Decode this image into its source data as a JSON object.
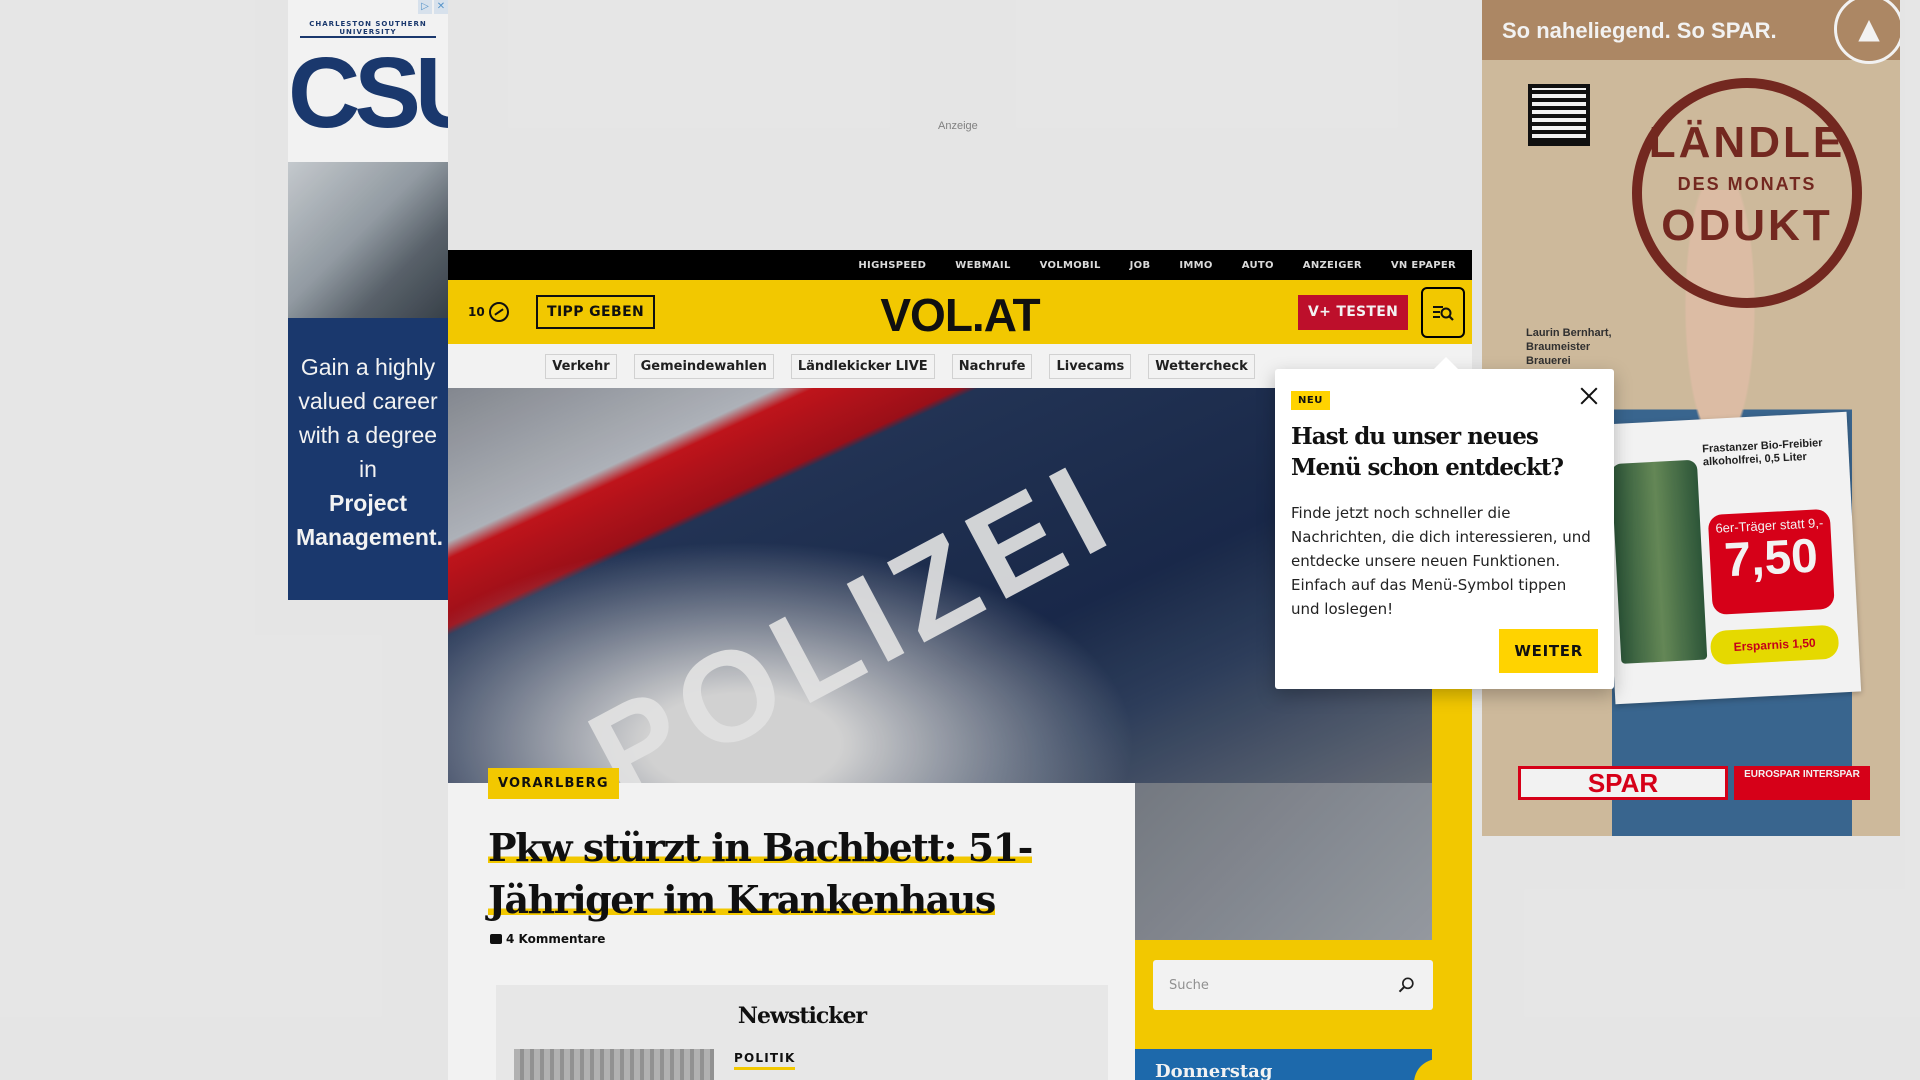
{
  "ads": {
    "left": {
      "university": "CHARLESTON SOUTHERN UNIVERSITY",
      "logo": "CSU",
      "text_line1": "Gain a highly valued career with a degree in",
      "text_line2": "Project Management.",
      "controls": [
        "▷",
        "✕"
      ]
    },
    "top_label": "Anzeige",
    "right": {
      "headline": "So naheliegend. So SPAR.",
      "stamp_top": "LÄNDLE",
      "stamp_mid": "DES MONATS",
      "stamp_bottom": "ODUKT",
      "caption": "Laurin Bernhart, Braumeister Brauerei",
      "product": "Frastanzer Bio-Freibier alkoholfrei, 0,5 Liter",
      "price_old": "6er-Träger statt 9,-",
      "price_new": "7,50",
      "saving": "Ersparnis 1,50",
      "brand": "SPAR",
      "brand_sub": "EUROSPAR INTERSPAR"
    }
  },
  "site": {
    "utility_links": [
      "HIGHSPEED",
      "WEBMAIL",
      "VOLMOBIL",
      "JOB",
      "IMMO",
      "AUTO",
      "ANZEIGER",
      "VN EPAPER"
    ],
    "counter": "10",
    "tipp_label": "TIPP GEBEN",
    "logo": "VOL.AT",
    "vplus_label": "V+ TESTEN",
    "nav": [
      "Verkehr",
      "Gemeindewahlen",
      "Ländlekicker LIVE",
      "Nachrufe",
      "Livecams",
      "Wettercheck"
    ],
    "hero_text": "POLIZEI"
  },
  "article": {
    "category": "VORARLBERG",
    "headline_line1": "Pkw stürzt in Bachbett: 51-",
    "headline_line2": "Jähriger im Krankenhaus",
    "comments": "4 Kommentare"
  },
  "newsticker": {
    "title": "Newsticker",
    "first_category": "POLITIK"
  },
  "sidebar": {
    "search_placeholder": "Suche",
    "weather_day": "Donnerstag"
  },
  "popover": {
    "badge": "NEU",
    "title": "Hast du unser neues Menü schon entdeckt?",
    "body": "Finde jetzt noch schneller die Nachrichten, die dich interessieren, und entdecke unsere neuen Funktionen. Einfach auf das Menü-Symbol tippen und loslegen!",
    "button": "WEITER"
  },
  "colors": {
    "brand_yellow": "#ffd300",
    "vplus_red": "#c8102e",
    "utility_black": "#000000"
  }
}
